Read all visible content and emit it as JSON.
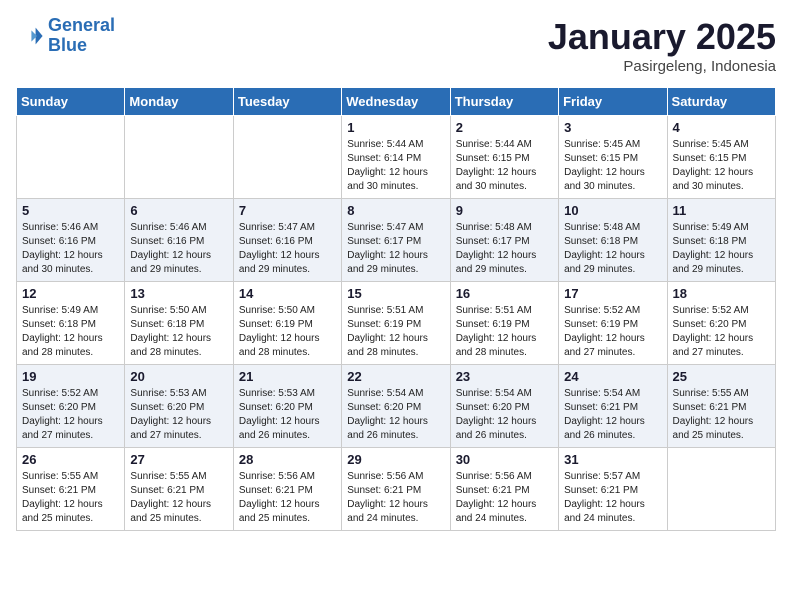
{
  "header": {
    "logo_line1": "General",
    "logo_line2": "Blue",
    "month_title": "January 2025",
    "subtitle": "Pasirgeleng, Indonesia"
  },
  "weekdays": [
    "Sunday",
    "Monday",
    "Tuesday",
    "Wednesday",
    "Thursday",
    "Friday",
    "Saturday"
  ],
  "weeks": [
    [
      {
        "day": "",
        "detail": ""
      },
      {
        "day": "",
        "detail": ""
      },
      {
        "day": "",
        "detail": ""
      },
      {
        "day": "1",
        "detail": "Sunrise: 5:44 AM\nSunset: 6:14 PM\nDaylight: 12 hours\nand 30 minutes."
      },
      {
        "day": "2",
        "detail": "Sunrise: 5:44 AM\nSunset: 6:15 PM\nDaylight: 12 hours\nand 30 minutes."
      },
      {
        "day": "3",
        "detail": "Sunrise: 5:45 AM\nSunset: 6:15 PM\nDaylight: 12 hours\nand 30 minutes."
      },
      {
        "day": "4",
        "detail": "Sunrise: 5:45 AM\nSunset: 6:15 PM\nDaylight: 12 hours\nand 30 minutes."
      }
    ],
    [
      {
        "day": "5",
        "detail": "Sunrise: 5:46 AM\nSunset: 6:16 PM\nDaylight: 12 hours\nand 30 minutes."
      },
      {
        "day": "6",
        "detail": "Sunrise: 5:46 AM\nSunset: 6:16 PM\nDaylight: 12 hours\nand 29 minutes."
      },
      {
        "day": "7",
        "detail": "Sunrise: 5:47 AM\nSunset: 6:16 PM\nDaylight: 12 hours\nand 29 minutes."
      },
      {
        "day": "8",
        "detail": "Sunrise: 5:47 AM\nSunset: 6:17 PM\nDaylight: 12 hours\nand 29 minutes."
      },
      {
        "day": "9",
        "detail": "Sunrise: 5:48 AM\nSunset: 6:17 PM\nDaylight: 12 hours\nand 29 minutes."
      },
      {
        "day": "10",
        "detail": "Sunrise: 5:48 AM\nSunset: 6:18 PM\nDaylight: 12 hours\nand 29 minutes."
      },
      {
        "day": "11",
        "detail": "Sunrise: 5:49 AM\nSunset: 6:18 PM\nDaylight: 12 hours\nand 29 minutes."
      }
    ],
    [
      {
        "day": "12",
        "detail": "Sunrise: 5:49 AM\nSunset: 6:18 PM\nDaylight: 12 hours\nand 28 minutes."
      },
      {
        "day": "13",
        "detail": "Sunrise: 5:50 AM\nSunset: 6:18 PM\nDaylight: 12 hours\nand 28 minutes."
      },
      {
        "day": "14",
        "detail": "Sunrise: 5:50 AM\nSunset: 6:19 PM\nDaylight: 12 hours\nand 28 minutes."
      },
      {
        "day": "15",
        "detail": "Sunrise: 5:51 AM\nSunset: 6:19 PM\nDaylight: 12 hours\nand 28 minutes."
      },
      {
        "day": "16",
        "detail": "Sunrise: 5:51 AM\nSunset: 6:19 PM\nDaylight: 12 hours\nand 28 minutes."
      },
      {
        "day": "17",
        "detail": "Sunrise: 5:52 AM\nSunset: 6:19 PM\nDaylight: 12 hours\nand 27 minutes."
      },
      {
        "day": "18",
        "detail": "Sunrise: 5:52 AM\nSunset: 6:20 PM\nDaylight: 12 hours\nand 27 minutes."
      }
    ],
    [
      {
        "day": "19",
        "detail": "Sunrise: 5:52 AM\nSunset: 6:20 PM\nDaylight: 12 hours\nand 27 minutes."
      },
      {
        "day": "20",
        "detail": "Sunrise: 5:53 AM\nSunset: 6:20 PM\nDaylight: 12 hours\nand 27 minutes."
      },
      {
        "day": "21",
        "detail": "Sunrise: 5:53 AM\nSunset: 6:20 PM\nDaylight: 12 hours\nand 26 minutes."
      },
      {
        "day": "22",
        "detail": "Sunrise: 5:54 AM\nSunset: 6:20 PM\nDaylight: 12 hours\nand 26 minutes."
      },
      {
        "day": "23",
        "detail": "Sunrise: 5:54 AM\nSunset: 6:20 PM\nDaylight: 12 hours\nand 26 minutes."
      },
      {
        "day": "24",
        "detail": "Sunrise: 5:54 AM\nSunset: 6:21 PM\nDaylight: 12 hours\nand 26 minutes."
      },
      {
        "day": "25",
        "detail": "Sunrise: 5:55 AM\nSunset: 6:21 PM\nDaylight: 12 hours\nand 25 minutes."
      }
    ],
    [
      {
        "day": "26",
        "detail": "Sunrise: 5:55 AM\nSunset: 6:21 PM\nDaylight: 12 hours\nand 25 minutes."
      },
      {
        "day": "27",
        "detail": "Sunrise: 5:55 AM\nSunset: 6:21 PM\nDaylight: 12 hours\nand 25 minutes."
      },
      {
        "day": "28",
        "detail": "Sunrise: 5:56 AM\nSunset: 6:21 PM\nDaylight: 12 hours\nand 25 minutes."
      },
      {
        "day": "29",
        "detail": "Sunrise: 5:56 AM\nSunset: 6:21 PM\nDaylight: 12 hours\nand 24 minutes."
      },
      {
        "day": "30",
        "detail": "Sunrise: 5:56 AM\nSunset: 6:21 PM\nDaylight: 12 hours\nand 24 minutes."
      },
      {
        "day": "31",
        "detail": "Sunrise: 5:57 AM\nSunset: 6:21 PM\nDaylight: 12 hours\nand 24 minutes."
      },
      {
        "day": "",
        "detail": ""
      }
    ]
  ]
}
